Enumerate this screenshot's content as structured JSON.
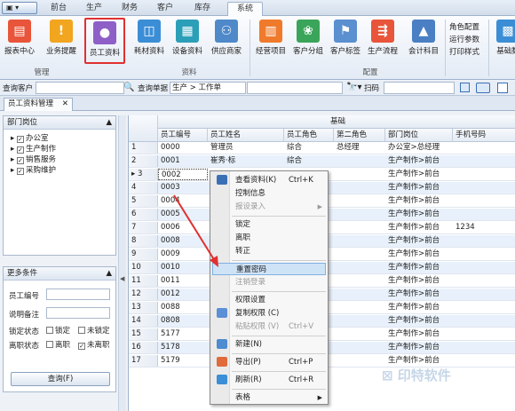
{
  "app_menu": "▣ ▾",
  "top_tabs": [
    "前台",
    "生产",
    "财务",
    "客户",
    "库存",
    "系统"
  ],
  "ribbon": {
    "buttons": [
      {
        "label": "报表中心",
        "color": "#e8553a"
      },
      {
        "label": "业务提醒",
        "color": "#f2a51f"
      },
      {
        "label": "员工资料",
        "color": "#8e5fc7"
      },
      {
        "label": "耗材资料",
        "color": "#3b8ed6"
      },
      {
        "label": "设备资料",
        "color": "#2c9fb8"
      },
      {
        "label": "供应商家",
        "color": "#4f89c9"
      },
      {
        "label": "经营项目",
        "color": "#f07a2c"
      },
      {
        "label": "客户分组",
        "color": "#3aa55a"
      },
      {
        "label": "客户标签",
        "color": "#5a8fd0"
      },
      {
        "label": "生产流程",
        "color": "#e8553a"
      },
      {
        "label": "会计科目",
        "color": "#4a7fc4"
      },
      {
        "label": "基础数",
        "color": "#3b8ed6"
      }
    ],
    "groups": [
      "管理",
      "资料",
      "配置"
    ],
    "small_items": [
      "角色配置",
      "运行参数",
      "打印样式"
    ]
  },
  "searchbar": {
    "customer_label": "查询客户",
    "order_label": "查询单据",
    "order_value": "生产 > 工作单",
    "scan_label": "扫码"
  },
  "doc_tab": "员工资料管理",
  "left_panel": {
    "dept_header": "部门岗位",
    "depts": [
      "办公室",
      "生产制作",
      "销售服务",
      "采购维护"
    ],
    "more_header": "更多条件",
    "employee_no_label": "员工编号",
    "note_label": "说明备注",
    "lock_label": "锁定状态",
    "locked": "锁定",
    "unlocked": "未锁定",
    "leave_label": "离职状态",
    "left_job": "离职",
    "not_left": "未离职",
    "query_button": "查询(F)"
  },
  "grid": {
    "group_header": "基础",
    "columns": [
      "员工编号",
      "员工姓名",
      "员工角色",
      "第二角色",
      "部门岗位",
      "手机号码"
    ],
    "rows": [
      {
        "n": "1",
        "id": "0000",
        "name": "管理员",
        "role": "综合",
        "role2": "总经理",
        "dept": "办公室>总经理",
        "phone": ""
      },
      {
        "n": "2",
        "id": "0001",
        "name": "崔秀·标",
        "role": "综合",
        "role2": "",
        "dept": "生产制作>前台",
        "phone": ""
      },
      {
        "n": "3",
        "id": "0002",
        "name": "",
        "role": "",
        "role2": "",
        "dept": "生产制作>前台",
        "phone": ""
      },
      {
        "n": "4",
        "id": "0003",
        "name": "",
        "role": "",
        "role2": "",
        "dept": "生产制作>前台",
        "phone": ""
      },
      {
        "n": "5",
        "id": "0004",
        "name": "",
        "role": "",
        "role2": "",
        "dept": "生产制作>前台",
        "phone": ""
      },
      {
        "n": "6",
        "id": "0005",
        "name": "",
        "role": "",
        "role2": "",
        "dept": "生产制作>前台",
        "phone": ""
      },
      {
        "n": "7",
        "id": "0006",
        "name": "",
        "role": "",
        "role2": "",
        "dept": "生产制作>前台",
        "phone": "1234"
      },
      {
        "n": "8",
        "id": "0008",
        "name": "",
        "role": "",
        "role2": "",
        "dept": "生产制作>前台",
        "phone": ""
      },
      {
        "n": "9",
        "id": "0009",
        "name": "",
        "role": "",
        "role2": "",
        "dept": "生产制作>前台",
        "phone": ""
      },
      {
        "n": "10",
        "id": "0010",
        "name": "",
        "role": "",
        "role2": "",
        "dept": "生产制作>前台",
        "phone": ""
      },
      {
        "n": "11",
        "id": "0011",
        "name": "",
        "role": "",
        "role2": "",
        "dept": "生产制作>前台",
        "phone": ""
      },
      {
        "n": "12",
        "id": "0012",
        "name": "",
        "role": "",
        "role2": "",
        "dept": "生产制作>前台",
        "phone": ""
      },
      {
        "n": "13",
        "id": "0088",
        "name": "",
        "role": "",
        "role2": "",
        "dept": "生产制作>前台",
        "phone": ""
      },
      {
        "n": "14",
        "id": "0808",
        "name": "",
        "role": "",
        "role2": "",
        "dept": "生产制作>前台",
        "phone": ""
      },
      {
        "n": "15",
        "id": "5177",
        "name": "",
        "role": "",
        "role2": "",
        "dept": "生产制作>前台",
        "phone": ""
      },
      {
        "n": "16",
        "id": "5178",
        "name": "",
        "role": "",
        "role2": "",
        "dept": "生产制作>前台",
        "phone": ""
      },
      {
        "n": "17",
        "id": "5179",
        "name": "",
        "role": "",
        "role2": "",
        "dept": "生产制作>前台",
        "phone": ""
      }
    ]
  },
  "context_menu": [
    {
      "label": "查看资料(K)",
      "shortcut": "Ctrl+K",
      "icon": "#3b6fb5"
    },
    {
      "label": "控制信息",
      "shortcut": ""
    },
    {
      "label": "报设录入",
      "shortcut": "",
      "disabled": true,
      "submenu": true
    },
    {
      "sep": true
    },
    {
      "label": "锁定",
      "shortcut": ""
    },
    {
      "label": "离职",
      "shortcut": ""
    },
    {
      "label": "转正",
      "shortcut": ""
    },
    {
      "sep": true
    },
    {
      "label": "重置密码",
      "shortcut": "",
      "highlight": true
    },
    {
      "label": "注销登录",
      "shortcut": "",
      "disabled": true
    },
    {
      "sep": true
    },
    {
      "label": "权限设置",
      "shortcut": ""
    },
    {
      "label": "复制权限 (C)",
      "shortcut": "",
      "icon": "#5b8fd6"
    },
    {
      "label": "粘贴权限 (V)",
      "shortcut": "Ctrl+V",
      "disabled": true
    },
    {
      "sep": true
    },
    {
      "label": "新建(N)",
      "shortcut": "",
      "icon": "#4e8bd0"
    },
    {
      "sep": true
    },
    {
      "label": "导出(P)",
      "shortcut": "Ctrl+P",
      "icon": "#e06a3a"
    },
    {
      "sep": true
    },
    {
      "label": "刷新(R)",
      "shortcut": "Ctrl+R",
      "icon": "#3a8fd6"
    },
    {
      "sep": true
    },
    {
      "label": "表格",
      "shortcut": "",
      "submenu": true
    }
  ],
  "watermark": "印特软件"
}
